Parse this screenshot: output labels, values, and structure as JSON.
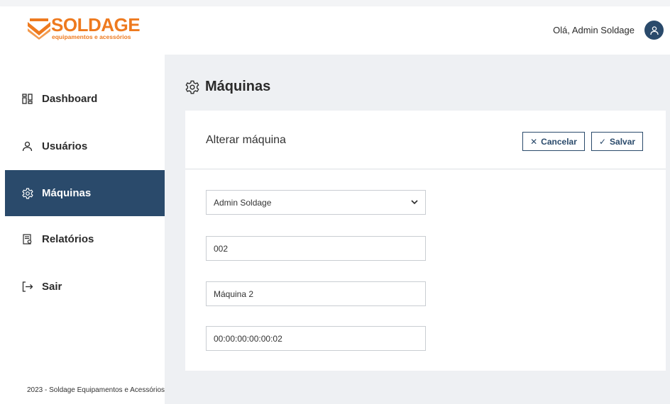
{
  "header": {
    "logo_word": "SOLDAGE",
    "logo_tagline": "equipamentos e acessórios",
    "greeting": "Olá, Admin Soldage",
    "user_icon": "user-icon"
  },
  "sidebar": {
    "items": [
      {
        "label": "Dashboard",
        "icon": "dashboard-grid-icon",
        "active": false
      },
      {
        "label": "Usuários",
        "icon": "user-icon",
        "active": false
      },
      {
        "label": "Máquinas",
        "icon": "gear-icon",
        "active": true
      },
      {
        "label": "Relatórios",
        "icon": "report-icon",
        "active": false
      },
      {
        "label": "Sair",
        "icon": "logout-icon",
        "active": false
      }
    ],
    "footer": "2023 - Soldage Equipamentos e Acessórios"
  },
  "page": {
    "title": "Máquinas",
    "title_icon": "gear-icon"
  },
  "form": {
    "title": "Alterar máquina",
    "cancel_label": "Cancelar",
    "save_label": "Salvar",
    "owner_select": "Admin Soldage",
    "code": "002",
    "name": "Máquina 2",
    "mac_address": "00:00:00:00:00:02"
  },
  "colors": {
    "brand_orange": "#ee7a1f",
    "primary_navy": "#2a4a6b",
    "content_bg": "#eef0f3"
  }
}
